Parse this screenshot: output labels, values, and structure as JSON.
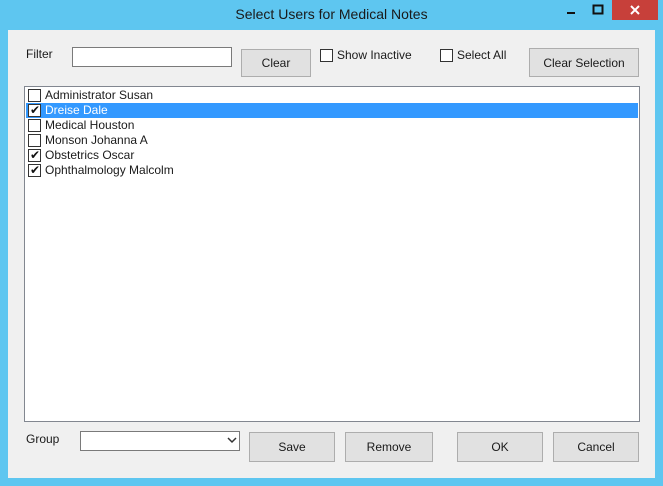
{
  "window": {
    "title": "Select Users for Medical Notes"
  },
  "filter": {
    "label": "Filter",
    "value": ""
  },
  "buttons": {
    "clear": "Clear",
    "clear_selection": "Clear Selection",
    "save": "Save",
    "remove": "Remove",
    "ok": "OK",
    "cancel": "Cancel"
  },
  "options": {
    "show_inactive": "Show Inactive",
    "select_all": "Select All"
  },
  "users": [
    {
      "name": "Administrator Susan",
      "checked": false,
      "selected": false
    },
    {
      "name": "Dreise Dale",
      "checked": true,
      "selected": true
    },
    {
      "name": "Medical Houston",
      "checked": false,
      "selected": false
    },
    {
      "name": "Monson Johanna A",
      "checked": false,
      "selected": false
    },
    {
      "name": "Obstetrics Oscar",
      "checked": true,
      "selected": false
    },
    {
      "name": "Ophthalmology Malcolm",
      "checked": true,
      "selected": false
    }
  ],
  "group": {
    "label": "Group",
    "value": ""
  },
  "colors": {
    "titlebar": "#5ec6f0",
    "selection": "#3399ff",
    "close_button": "#c7403a"
  }
}
